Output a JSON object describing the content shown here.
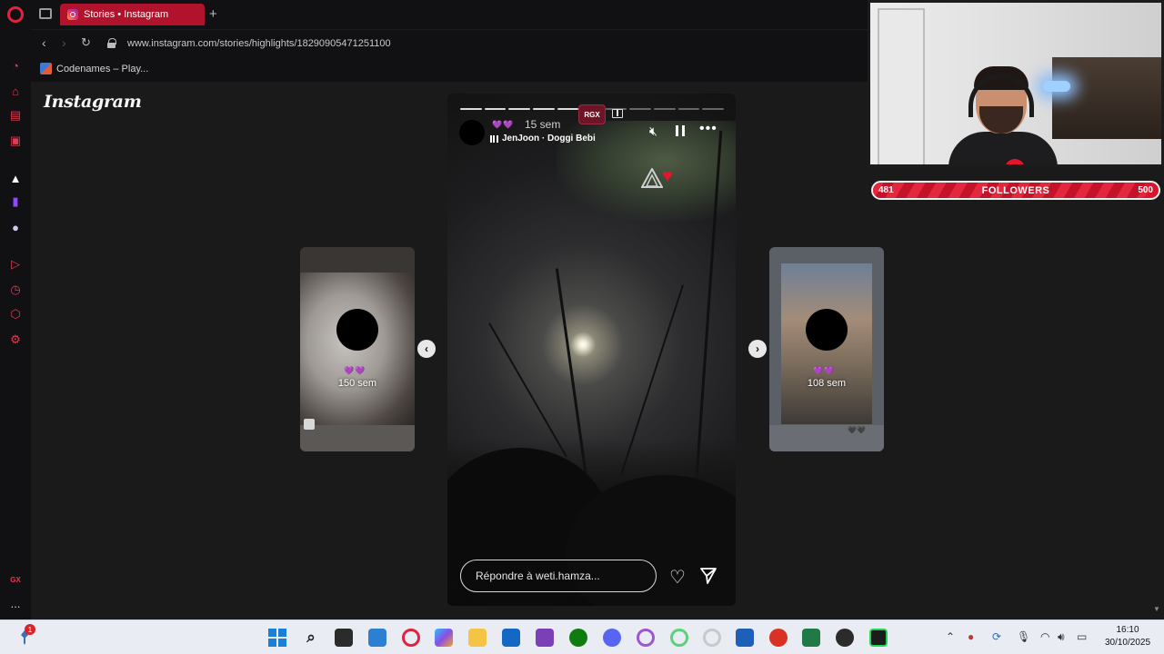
{
  "browser": {
    "tab": {
      "title": "Stories • Instagram",
      "favicon": "instagram-icon"
    },
    "new_tab_label": "+",
    "url": "www.instagram.com/stories/highlights/18290905471251100",
    "bookmark": {
      "label": "Codenames – Play..."
    },
    "sidebar_icons": [
      "opera-gx-logo",
      "speed-dial-icon",
      "shopping-icon",
      "gx-corner-icon",
      "news-icon",
      "aria-icon",
      "twitch-icon",
      "discord-icon",
      "player-icon",
      "history-icon",
      "extensions-icon",
      "settings-icon"
    ],
    "sidebar_bottom": {
      "gx_label": "GX",
      "more_label": "..."
    },
    "accent": "#e0243f"
  },
  "instagram": {
    "logo": "Instagram",
    "left_card": {
      "hearts": "💜💜",
      "time": "150 sem"
    },
    "right_card": {
      "hearts": "💜💜",
      "time": "108 sem",
      "tag": "🖤🖤"
    },
    "story": {
      "hearts": "💜💜",
      "time": "15 sem",
      "music": "JenJoon · Doggi Bebi",
      "rgx_badge": "RGX",
      "reply_placeholder": "Répondre à weti.hamza...",
      "more_label": "•••",
      "progress_total": 11,
      "progress_seen": 6
    },
    "prev_arrow": "‹",
    "next_arrow": "›"
  },
  "stream_overlay": {
    "followers_current": "481",
    "followers_label": "FOLLOWERS",
    "followers_goal": "500",
    "fill_fraction": 0.962
  },
  "taskbar": {
    "notification_count": "1",
    "time": "16:10",
    "date": "30/10/2025"
  }
}
